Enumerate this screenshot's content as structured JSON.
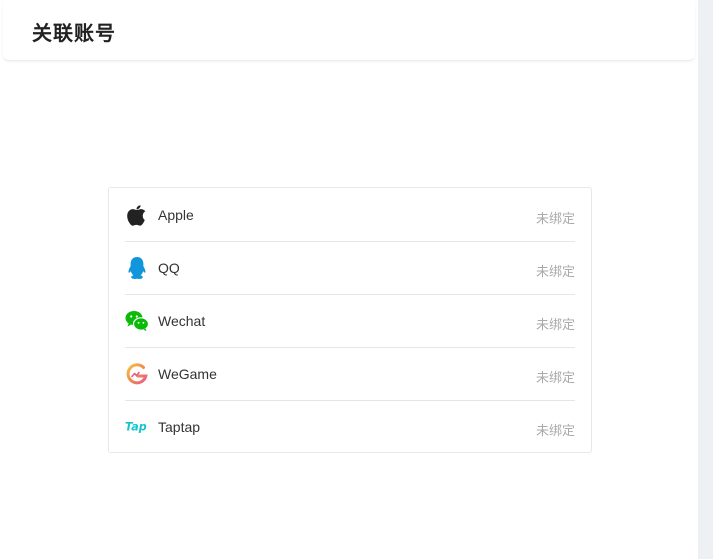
{
  "header": {
    "title": "关联账号"
  },
  "accounts": [
    {
      "name": "Apple",
      "icon": "apple-icon",
      "status": "未绑定"
    },
    {
      "name": "QQ",
      "icon": "qq-icon",
      "status": "未绑定"
    },
    {
      "name": "Wechat",
      "icon": "wechat-icon",
      "status": "未绑定"
    },
    {
      "name": "WeGame",
      "icon": "wegame-icon",
      "status": "未绑定"
    },
    {
      "name": "Taptap",
      "icon": "taptap-icon",
      "status": "未绑定"
    }
  ],
  "colors": {
    "qq": "#1296db",
    "wechat": "#09bb07",
    "taptap": "#15c5ce",
    "status": "#aaaaaa"
  }
}
